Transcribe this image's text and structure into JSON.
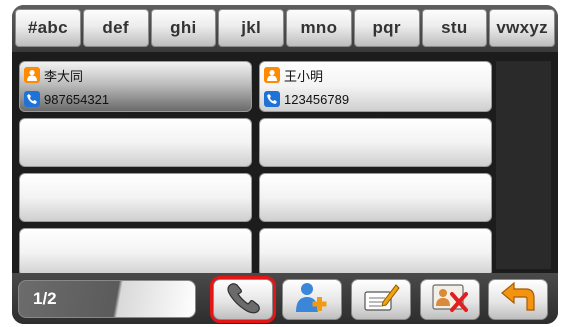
{
  "tabs": [
    "#abc",
    "def",
    "ghi",
    "jkl",
    "mno",
    "pqr",
    "stu",
    "vwxyz"
  ],
  "contacts": [
    {
      "name": "李大同",
      "phone": "987654321",
      "selected": true
    },
    {
      "name": "王小明",
      "phone": "123456789",
      "selected": false
    }
  ],
  "pager": {
    "label": "1/2"
  },
  "toolbar": {
    "icons": [
      "phone-handset-icon",
      "add-contact-icon",
      "edit-note-icon",
      "delete-contact-icon",
      "back-arrow-icon"
    ]
  },
  "colors": {
    "person_icon": "#ff8a00",
    "phone_icon": "#1f72d8",
    "highlight": "#e11717"
  }
}
